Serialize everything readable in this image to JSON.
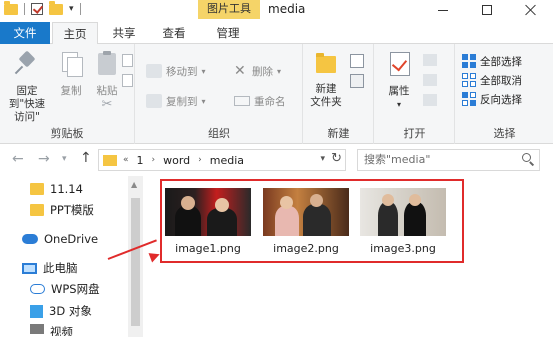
{
  "title_bar": {
    "context_tab": "图片工具",
    "window_title": "media"
  },
  "tabs": {
    "file": "文件",
    "home": "主页",
    "share": "共享",
    "view": "查看",
    "manage": "管理"
  },
  "ribbon": {
    "clipboard": {
      "label": "剪贴板",
      "pin": "固定到\"快速访问\"",
      "copy": "复制",
      "paste": "粘贴"
    },
    "organize": {
      "label": "组织",
      "move_to": "移动到",
      "copy_to": "复制到",
      "delete": "删除",
      "rename": "重命名"
    },
    "new": {
      "label": "新建",
      "new_folder": "新建\n文件夹"
    },
    "open": {
      "label": "打开",
      "properties": "属性"
    },
    "select": {
      "label": "选择",
      "select_all": "全部选择",
      "select_none": "全部取消",
      "invert": "反向选择"
    }
  },
  "address": {
    "path": [
      "1",
      "word",
      "media"
    ],
    "search_placeholder": "搜索\"media\""
  },
  "nav_pane": {
    "items": [
      {
        "label": "11.14",
        "icon": "folder-icon"
      },
      {
        "label": "PPT模版",
        "icon": "folder-icon"
      },
      {
        "label": "OneDrive",
        "icon": "cloud-icon"
      },
      {
        "label": "此电脑",
        "icon": "pc-icon"
      },
      {
        "label": "WPS网盘",
        "icon": "wps-cloud-icon"
      },
      {
        "label": "3D 对象",
        "icon": "3d-object-icon"
      },
      {
        "label": "视频",
        "icon": "video-icon"
      }
    ]
  },
  "files": [
    {
      "name": "image1.png"
    },
    {
      "name": "image2.png"
    },
    {
      "name": "image3.png"
    }
  ],
  "colors": {
    "file_tab": "#1979ca",
    "context_tab": "#f5d468",
    "annotation": "#e02b2b"
  }
}
